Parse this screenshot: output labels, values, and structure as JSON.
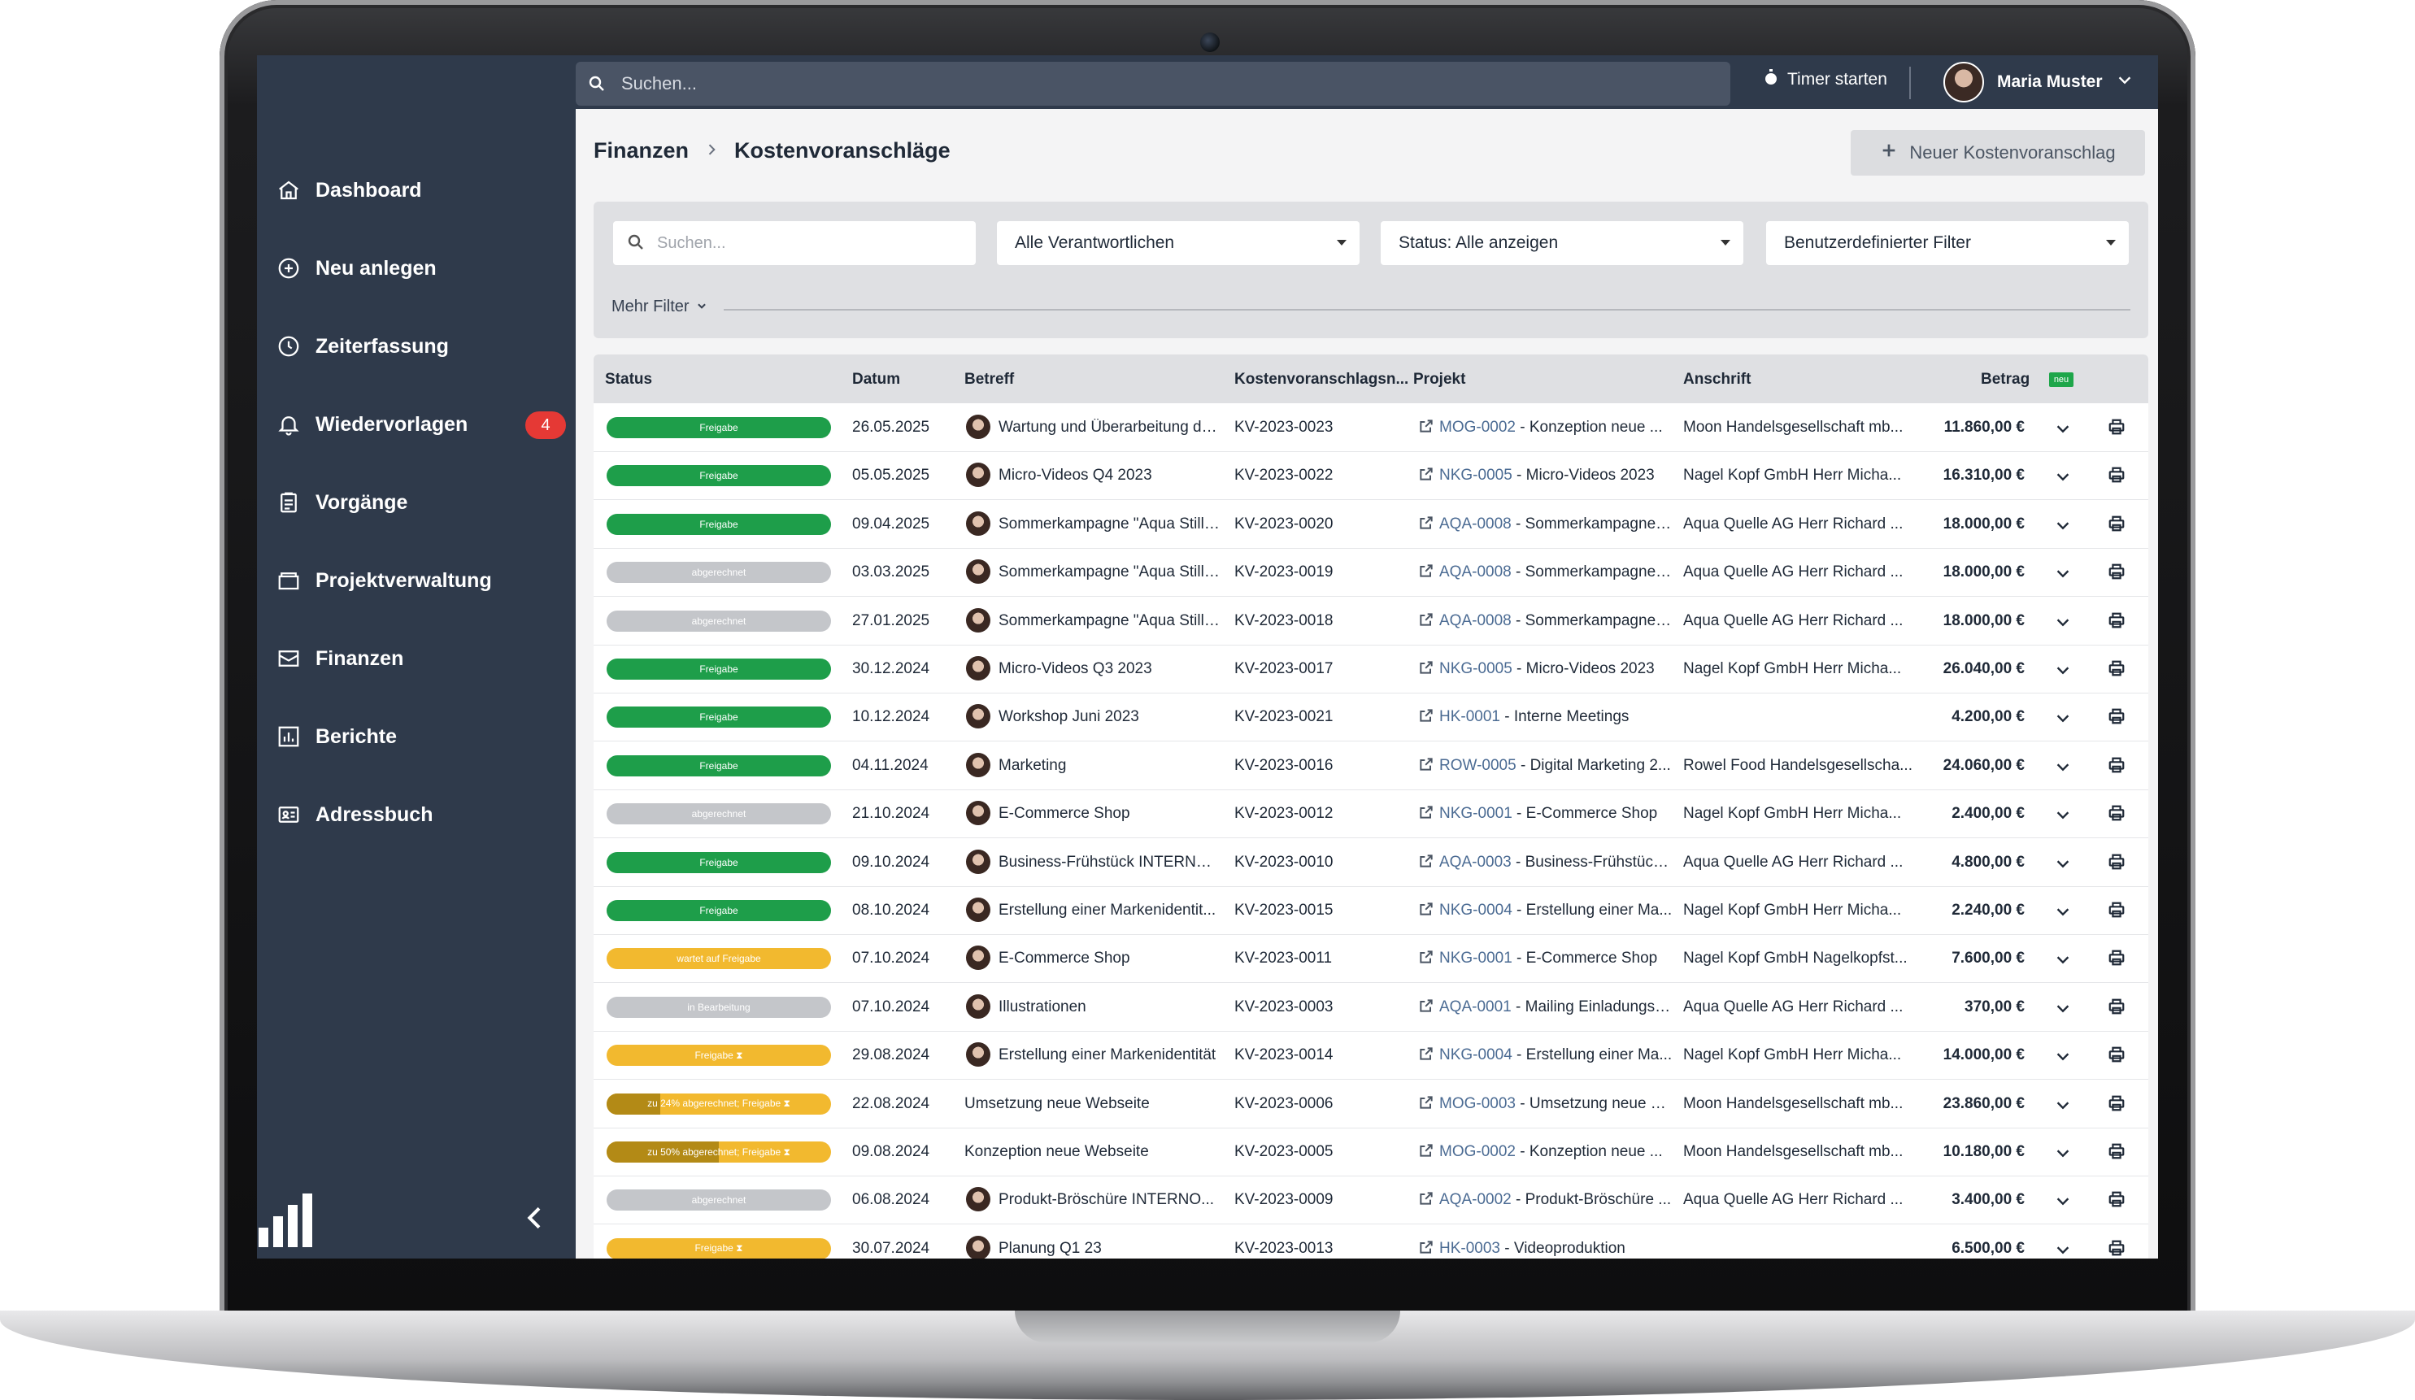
{
  "sidebar": {
    "items": [
      {
        "label": "Dashboard",
        "icon": "home-icon"
      },
      {
        "label": "Neu anlegen",
        "icon": "plus-circle-icon"
      },
      {
        "label": "Zeiterfassung",
        "icon": "clock-icon"
      },
      {
        "label": "Wiedervorlagen",
        "icon": "bell-icon",
        "badge": "4"
      },
      {
        "label": "Vorgänge",
        "icon": "clipboard-icon"
      },
      {
        "label": "Projektverwaltung",
        "icon": "folder-icon"
      },
      {
        "label": "Finanzen",
        "icon": "finance-icon"
      },
      {
        "label": "Berichte",
        "icon": "chart-icon"
      },
      {
        "label": "Adressbuch",
        "icon": "address-book-icon"
      }
    ]
  },
  "topbar": {
    "search_placeholder": "Suchen...",
    "timer_label": "Timer starten",
    "user_name": "Maria Muster"
  },
  "breadcrumb": {
    "parent": "Finanzen",
    "current": "Kostenvoranschläge"
  },
  "new_button": "Neuer Kostenvoranschlag",
  "filters": {
    "search_placeholder": "Suchen...",
    "responsible": "Alle Verantwortlichen",
    "status": "Status: Alle anzeigen",
    "custom": "Benutzerdefinierter Filter",
    "more": "Mehr Filter"
  },
  "table": {
    "headers": {
      "status": "Status",
      "datum": "Datum",
      "betreff": "Betreff",
      "nummer": "Kostenvoranschlagsn...",
      "projekt": "Projekt",
      "anschrift": "Anschrift",
      "betrag": "Betrag",
      "neu": "neu"
    },
    "colors": {
      "green": "#1e9e4a",
      "grey": "#c4c6ca",
      "yellow": "#f2b92f"
    },
    "rows": [
      {
        "status": "Freigabe",
        "kind": "green",
        "datum": "26.05.2025",
        "avatar": true,
        "betreff": "Wartung und Überarbeitung de...",
        "nummer": "KV-2023-0023",
        "proj_code": "MOG-0002",
        "proj_name": " - Konzeption neue ...",
        "anschrift": "Moon Handelsgesellschaft mb...",
        "betrag": "11.860,00 €"
      },
      {
        "status": "Freigabe",
        "kind": "green",
        "datum": "05.05.2025",
        "avatar": true,
        "betreff": "Micro-Videos Q4 2023",
        "nummer": "KV-2023-0022",
        "proj_code": "NKG-0005",
        "proj_name": " - Micro-Videos 2023",
        "anschrift": "Nagel Kopf GmbH Herr Micha...",
        "betrag": "16.310,00 €"
      },
      {
        "status": "Freigabe",
        "kind": "green",
        "datum": "09.04.2025",
        "avatar": true,
        "betreff": "Sommerkampagne \"Aqua Still\" ...",
        "nummer": "KV-2023-0020",
        "proj_code": "AQA-0008",
        "proj_name": " - Sommerkampagne \"...",
        "anschrift": "Aqua Quelle AG Herr Richard ...",
        "betrag": "18.000,00 €"
      },
      {
        "status": "abgerechnet",
        "kind": "grey",
        "datum": "03.03.2025",
        "avatar": true,
        "betreff": "Sommerkampagne \"Aqua Still\" ...",
        "nummer": "KV-2023-0019",
        "proj_code": "AQA-0008",
        "proj_name": " - Sommerkampagne \"...",
        "anschrift": "Aqua Quelle AG Herr Richard ...",
        "betrag": "18.000,00 €"
      },
      {
        "status": "abgerechnet",
        "kind": "grey",
        "datum": "27.01.2025",
        "avatar": true,
        "betreff": "Sommerkampagne \"Aqua Still\" ...",
        "nummer": "KV-2023-0018",
        "proj_code": "AQA-0008",
        "proj_name": " - Sommerkampagne \"...",
        "anschrift": "Aqua Quelle AG Herr Richard ...",
        "betrag": "18.000,00 €"
      },
      {
        "status": "Freigabe",
        "kind": "green",
        "datum": "30.12.2024",
        "avatar": true,
        "betreff": "Micro-Videos Q3 2023",
        "nummer": "KV-2023-0017",
        "proj_code": "NKG-0005",
        "proj_name": " - Micro-Videos 2023",
        "anschrift": "Nagel Kopf GmbH Herr Micha...",
        "betrag": "26.040,00 €"
      },
      {
        "status": "Freigabe",
        "kind": "green",
        "datum": "10.12.2024",
        "avatar": true,
        "betreff": "Workshop Juni 2023",
        "nummer": "KV-2023-0021",
        "proj_code": "HK-0001",
        "proj_name": " - Interne Meetings",
        "anschrift": "",
        "betrag": "4.200,00 €"
      },
      {
        "status": "Freigabe",
        "kind": "green",
        "datum": "04.11.2024",
        "avatar": true,
        "betreff": "Marketing",
        "nummer": "KV-2023-0016",
        "proj_code": "ROW-0005",
        "proj_name": " - Digital Marketing 2...",
        "anschrift": "Rowel Food Handelsgesellscha...",
        "betrag": "24.060,00 €"
      },
      {
        "status": "abgerechnet",
        "kind": "grey",
        "datum": "21.10.2024",
        "avatar": true,
        "betreff": "E-Commerce Shop",
        "nummer": "KV-2023-0012",
        "proj_code": "NKG-0001",
        "proj_name": " - E-Commerce Shop",
        "anschrift": "Nagel Kopf GmbH Herr Micha...",
        "betrag": "2.400,00 €"
      },
      {
        "status": "Freigabe",
        "kind": "green",
        "datum": "09.10.2024",
        "avatar": true,
        "betreff": "Business-Frühstück INTERNO...",
        "nummer": "KV-2023-0010",
        "proj_code": "AQA-0003",
        "proj_name": " - Business-Frühstück ...",
        "anschrift": "Aqua Quelle AG Herr Richard ...",
        "betrag": "4.800,00 €"
      },
      {
        "status": "Freigabe",
        "kind": "green",
        "datum": "08.10.2024",
        "avatar": true,
        "betreff": "Erstellung einer Markenidentit...",
        "nummer": "KV-2023-0015",
        "proj_code": "NKG-0004",
        "proj_name": " - Erstellung einer Ma...",
        "anschrift": "Nagel Kopf GmbH Herr Micha...",
        "betrag": "2.240,00 €"
      },
      {
        "status": "wartet auf Freigabe",
        "kind": "yellow",
        "datum": "07.10.2024",
        "avatar": true,
        "betreff": "E-Commerce Shop",
        "nummer": "KV-2023-0011",
        "proj_code": "NKG-0001",
        "proj_name": " - E-Commerce Shop",
        "anschrift": "Nagel Kopf GmbH Nagelkopfst...",
        "betrag": "7.600,00 €"
      },
      {
        "status": "in Bearbeitung",
        "kind": "grey",
        "datum": "07.10.2024",
        "avatar": true,
        "betreff": "Illustrationen",
        "nummer": "KV-2023-0003",
        "proj_code": "AQA-0001",
        "proj_name": " - Mailing Einladungsk...",
        "anschrift": "Aqua Quelle AG Herr Richard ...",
        "betrag": "370,00 €"
      },
      {
        "status": "Freigabe ⧗",
        "kind": "yellow",
        "datum": "29.08.2024",
        "avatar": true,
        "betreff": "Erstellung einer Markenidentität",
        "nummer": "KV-2023-0014",
        "proj_code": "NKG-0004",
        "proj_name": " - Erstellung einer Ma...",
        "anschrift": "Nagel Kopf GmbH Herr Micha...",
        "betrag": "14.000,00 €"
      },
      {
        "status": "zu 24% abgerechnet; Freigabe ⧗",
        "kind": "yellow",
        "progress": 0.24,
        "datum": "22.08.2024",
        "avatar": false,
        "betreff": "Umsetzung neue Webseite",
        "nummer": "KV-2023-0006",
        "proj_code": "MOG-0003",
        "proj_name": " - Umsetzung neue W...",
        "anschrift": "Moon Handelsgesellschaft mb...",
        "betrag": "23.860,00 €"
      },
      {
        "status": "zu 50% abgerechnet; Freigabe ⧗",
        "kind": "yellow",
        "progress": 0.5,
        "datum": "09.08.2024",
        "avatar": false,
        "betreff": "Konzeption neue Webseite",
        "nummer": "KV-2023-0005",
        "proj_code": "MOG-0002",
        "proj_name": " - Konzeption neue ...",
        "anschrift": "Moon Handelsgesellschaft mb...",
        "betrag": "10.180,00 €"
      },
      {
        "status": "abgerechnet",
        "kind": "grey",
        "datum": "06.08.2024",
        "avatar": true,
        "betreff": "Produkt-Bröschüre INTERNO...",
        "nummer": "KV-2023-0009",
        "proj_code": "AQA-0002",
        "proj_name": " - Produkt-Bröschüre ...",
        "anschrift": "Aqua Quelle AG Herr Richard ...",
        "betrag": "3.400,00 €"
      },
      {
        "status": "Freigabe ⧗",
        "kind": "yellow",
        "datum": "30.07.2024",
        "avatar": true,
        "betreff": "Planung Q1 23",
        "nummer": "KV-2023-0013",
        "proj_code": "HK-0003",
        "proj_name": " - Videoproduktion",
        "anschrift": "",
        "betrag": "6.500,00 €"
      }
    ]
  }
}
